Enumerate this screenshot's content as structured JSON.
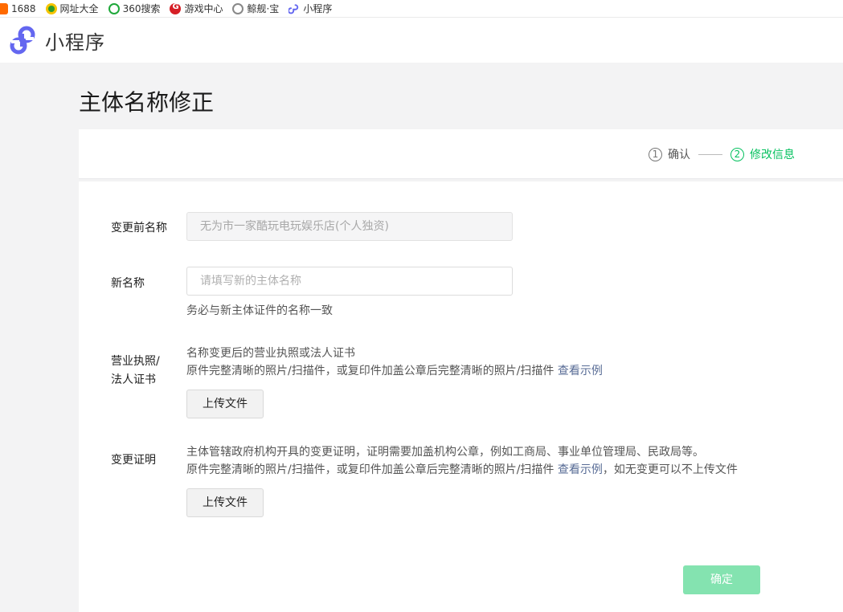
{
  "bookmarks": [
    {
      "label": "1688",
      "icon": "1688-icon"
    },
    {
      "label": "网址大全",
      "icon": "nav-icon"
    },
    {
      "label": "360搜索",
      "icon": "360-search-icon"
    },
    {
      "label": "游戏中心",
      "icon": "game-center-icon"
    },
    {
      "label": "鲸舰·宝",
      "icon": "globe-icon"
    },
    {
      "label": "小程序",
      "icon": "mini-program-icon"
    }
  ],
  "header": {
    "brand": "小程序",
    "logo_icon": "mini-program-logo-icon"
  },
  "page": {
    "title": "主体名称修正"
  },
  "steps": [
    {
      "num": "1",
      "label": "确认",
      "active": false
    },
    {
      "num": "2",
      "label": "修改信息",
      "active": true
    }
  ],
  "form": {
    "old_name": {
      "label": "变更前名称",
      "value": "无为市一家酷玩电玩娱乐店(个人独资)"
    },
    "new_name": {
      "label": "新名称",
      "placeholder": "请填写新的主体名称",
      "hint": "务必与新主体证件的名称一致"
    },
    "license": {
      "label_line1": "营业执照/",
      "label_line2": "法人证书",
      "desc1": "名称变更后的营业执照或法人证书",
      "desc2": "原件完整清晰的照片/扫描件，或复印件加盖公章后完整清晰的照片/扫描件",
      "example_link": "查看示例",
      "upload_label": "上传文件"
    },
    "proof": {
      "label": "变更证明",
      "desc1": "主体管辖政府机构开具的变更证明，证明需要加盖机构公章，例如工商局、事业单位管理局、民政局等。",
      "desc2": "原件完整清晰的照片/扫描件，或复印件加盖公章后完整清晰的照片/扫描件",
      "example_link": "查看示例",
      "desc2_suffix": "，如无变更可以不上传文件",
      "upload_label": "上传文件"
    },
    "confirm_label": "确定"
  },
  "colors": {
    "accent": "#07c160",
    "confirm_disabled": "#84e3b0",
    "link": "#576b95"
  }
}
